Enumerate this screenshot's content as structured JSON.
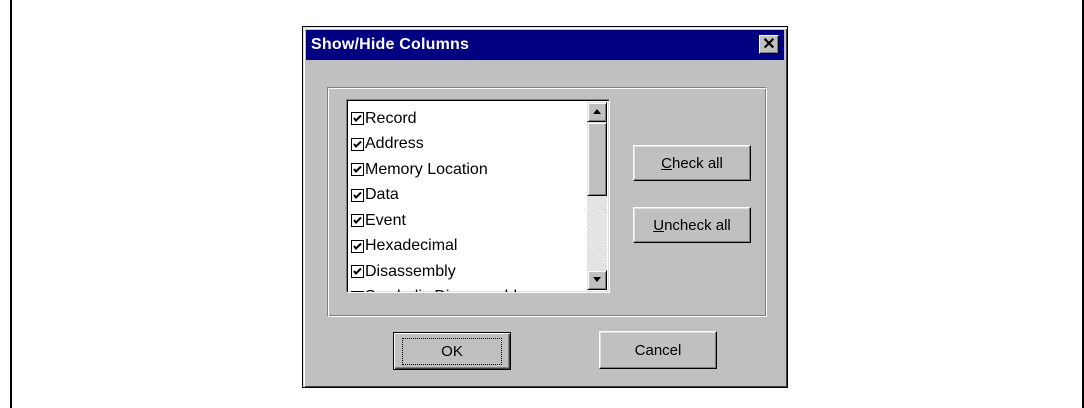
{
  "dialog": {
    "title": "Show/Hide Columns",
    "close_label": "✕"
  },
  "columns_list": {
    "items": [
      {
        "label": "Record",
        "checked": true
      },
      {
        "label": "Address",
        "checked": true
      },
      {
        "label": "Memory Location",
        "checked": true
      },
      {
        "label": "Data",
        "checked": true
      },
      {
        "label": "Event",
        "checked": true
      },
      {
        "label": "Hexadecimal",
        "checked": true
      },
      {
        "label": "Disassembly",
        "checked": true
      },
      {
        "label": "Symbolic Disassembly",
        "checked": true
      }
    ]
  },
  "buttons": {
    "check_all": {
      "mnemonic": "C",
      "rest": "heck all"
    },
    "uncheck_all": {
      "mnemonic": "U",
      "rest": "ncheck all"
    },
    "ok": "OK",
    "cancel": "Cancel"
  }
}
